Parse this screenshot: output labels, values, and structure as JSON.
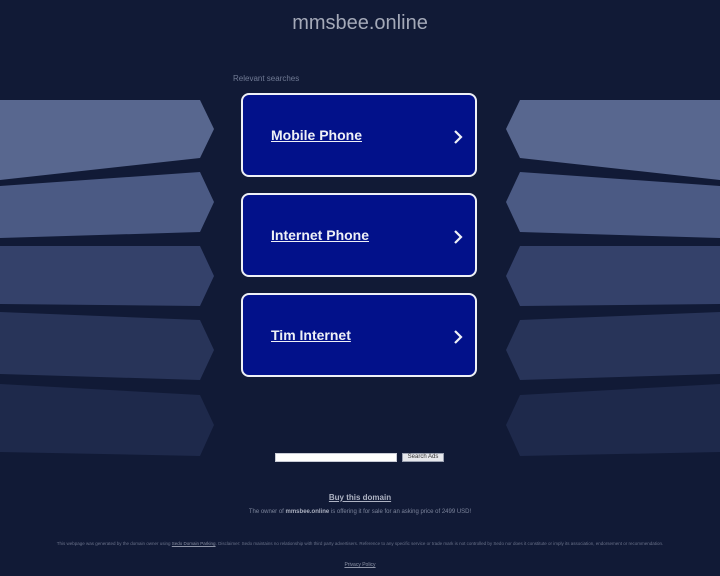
{
  "page": {
    "domain": "mmsbee.online",
    "relevant_searches_label": "Relevant searches"
  },
  "links": [
    {
      "label": "Mobile Phone",
      "icon": "chevron-right-icon"
    },
    {
      "label": "Internet Phone",
      "icon": "chevron-right-icon"
    },
    {
      "label": "Tim Internet",
      "icon": "chevron-right-icon"
    }
  ],
  "search": {
    "input_value": "",
    "button_label": "Search Ads"
  },
  "footer": {
    "buy_link": "Buy this domain",
    "owner_prefix": "The owner of ",
    "owner_domain": "mmsbee.online",
    "owner_suffix": " is offering it for sale for an asking price of 2499 USD!",
    "disclaimer_prefix": "This webpage was generated by the domain owner using ",
    "disclaimer_link": "Sedo Domain Parking",
    "disclaimer_suffix": ". Disclaimer: Sedo maintains no relationship with third party advertisers. Reference to any specific service or trade mark is not controlled by Sedo nor does it constitute or imply its association, endorsement or recommendation.",
    "privacy_link": "Privacy Policy"
  },
  "colors": {
    "background": "#111a36",
    "card_fill": "#02118a",
    "card_border": "#eef0f6",
    "card_text": "#eef0f6",
    "title_text": "#a4a9b8"
  }
}
